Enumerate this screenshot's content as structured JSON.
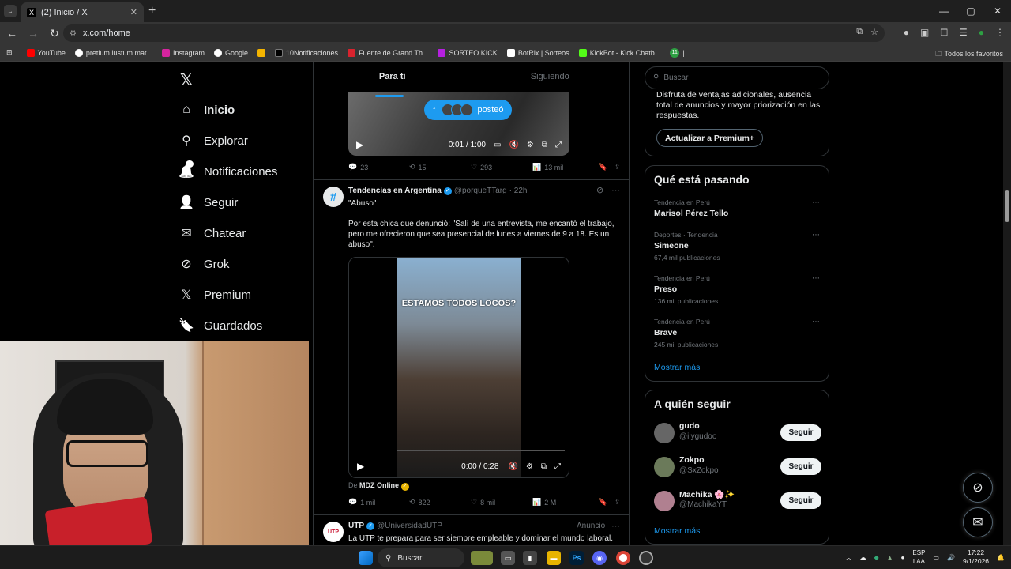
{
  "browser": {
    "tab_title": "(2) Inicio / X",
    "tab_close": "✕",
    "new_tab": "+",
    "url": "x.com/home",
    "window_controls": [
      "—",
      "▢",
      "✕"
    ],
    "bookmarks": [
      {
        "label": "YouTube",
        "color": "#ff0000"
      },
      {
        "label": "pretium iustum mat...",
        "color": "#ffffff"
      },
      {
        "label": "Instagram",
        "color": "#d6249f"
      },
      {
        "label": "Google",
        "color": "#4285f4"
      },
      {
        "label": "",
        "color": "#f4b400"
      },
      {
        "label": "10Notificaciones",
        "color": "#000000"
      },
      {
        "label": "Fuente de Grand Th...",
        "color": "#d9232e"
      },
      {
        "label": "SORTEO KICK",
        "color": "#b620e0"
      },
      {
        "label": "BotRix | Sorteos",
        "color": "#ffffff"
      },
      {
        "label": "KickBot - Kick Chatb...",
        "color": "#53fc18"
      },
      {
        "label": "11",
        "color": "#2ea043"
      }
    ],
    "all_bookmarks": "Todos los favoritos"
  },
  "sidebar": {
    "logo": "𝕏",
    "items": [
      {
        "label": "Inicio",
        "icon": "⌂"
      },
      {
        "label": "Explorar",
        "icon": "⚲"
      },
      {
        "label": "Notificaciones",
        "icon": "🔔",
        "badge": "2"
      },
      {
        "label": "Seguir",
        "icon": "👤"
      },
      {
        "label": "Chatear",
        "icon": "✉"
      },
      {
        "label": "Grok",
        "icon": "⊘"
      },
      {
        "label": "Premium",
        "icon": "𝕏"
      },
      {
        "label": "Guardados",
        "icon": "🔖"
      }
    ]
  },
  "timeline": {
    "tabs": [
      "Para ti",
      "Siguiendo"
    ],
    "posted_pill": "posteó",
    "video1": {
      "time": "0:01 / 1:00"
    },
    "tweet1_actions": {
      "replies": "23",
      "retweets": "15",
      "likes": "293",
      "views": "13 mil"
    },
    "tweet2": {
      "name": "Tendencias en Argentina",
      "handle": "@porqueTTarg",
      "time": "· 22h",
      "line1": "\"Abuso\"",
      "line2": "Por esta chica que denunció: \"Salí de una entrevista, me encantó el trabajo, pero me ofrecieron que sea presencial de lunes a viernes de 9 a 18. Es un abuso\".",
      "video_caption": "ESTAMOS TODOS LOCOS?",
      "video_time": "0:00 / 0:28",
      "via_prefix": "De",
      "via_name": "MDZ Online",
      "actions": {
        "replies": "1 mil",
        "retweets": "822",
        "likes": "8 mil",
        "views": "2 M"
      }
    },
    "tweet3": {
      "avatar_text": "UTP",
      "name": "UTP",
      "handle": "@UniversidadUTP",
      "ad": "Anuncio",
      "text": "La UTP te prepara para ser siempre empleable y dominar el mundo laboral."
    }
  },
  "right": {
    "search_placeholder": "Buscar",
    "premium_text": "Disfruta de ventajas adicionales, ausencia total de anuncios y mayor priorización en las respuestas.",
    "premium_button": "Actualizar a Premium+",
    "trends_title": "Qué está pasando",
    "trends": [
      {
        "context": "Tendencia en Perú",
        "name": "Marisol Pérez Tello",
        "count": ""
      },
      {
        "context": "Deportes · Tendencia",
        "name": "Simeone",
        "count": "67,4 mil publicaciones"
      },
      {
        "context": "Tendencia en Perú",
        "name": "Preso",
        "count": "136 mil publicaciones"
      },
      {
        "context": "Tendencia en Perú",
        "name": "Brave",
        "count": "245 mil publicaciones"
      }
    ],
    "show_more": "Mostrar más",
    "follow_title": "A quién seguir",
    "follow": [
      {
        "name": "gudo",
        "handle": "@ilygudoo",
        "button": "Seguir",
        "color": "#666666"
      },
      {
        "name": "Zokpo",
        "handle": "@SxZokpo",
        "button": "Seguir",
        "color": "#6b7a5a"
      },
      {
        "name": "Machika 🌸✨",
        "handle": "@MachikaYT",
        "button": "Seguir",
        "color": "#b08090"
      }
    ],
    "follow_more": "Mostrar más"
  },
  "taskbar": {
    "search": "Buscar",
    "lang_top": "ESP",
    "lang_bottom": "LAA",
    "time": "17:22",
    "date": "9/1/2026"
  }
}
